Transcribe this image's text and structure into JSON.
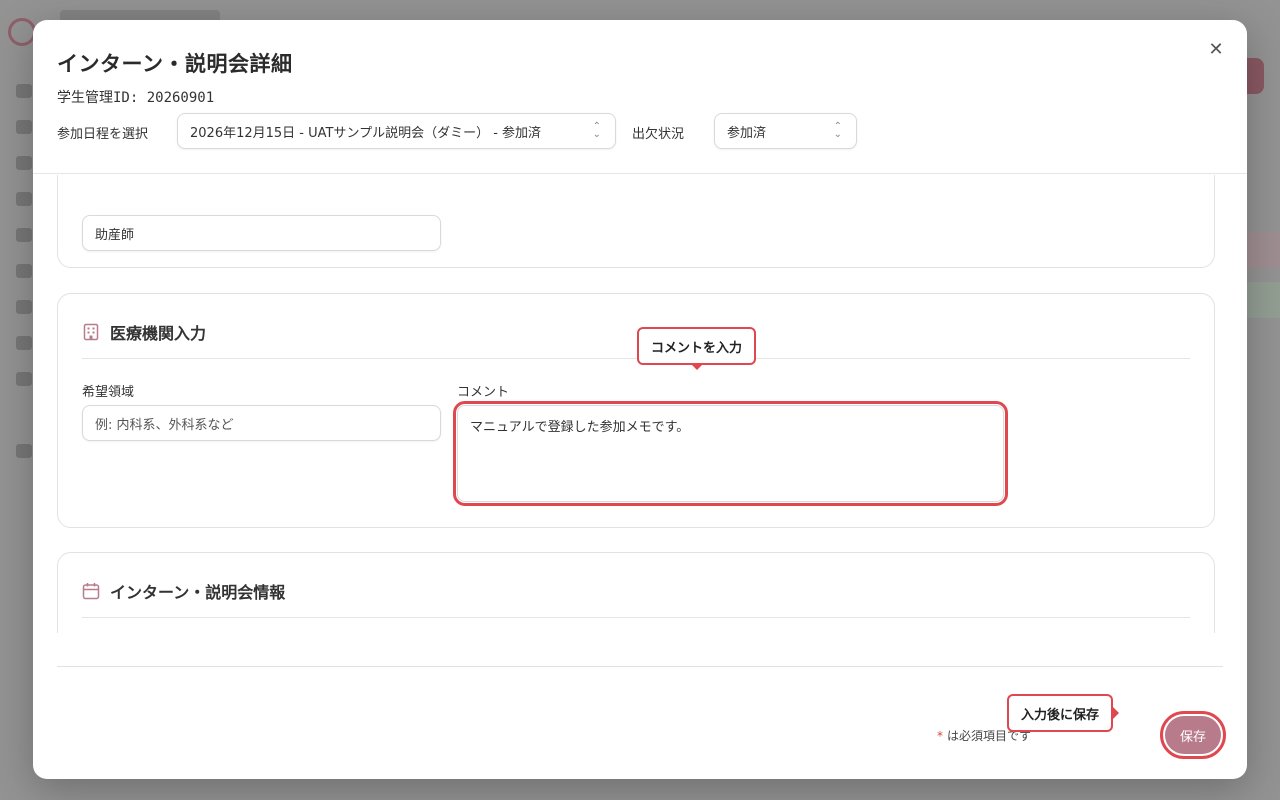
{
  "modal": {
    "title": "インターン・説明会詳細",
    "student_id": "学生管理ID: 20260901",
    "close_icon": "✕"
  },
  "schedule": {
    "label": "参加日程を選択",
    "value": "2026年12月15日 - UATサンプル説明会（ダミー） - 参加済"
  },
  "attendance": {
    "label": "出欠状況",
    "value": "参加済"
  },
  "card_profession": {
    "value": "助産師"
  },
  "card_medical": {
    "title": "医療機関入力",
    "icon": "building-icon",
    "desired_area_label": "希望領域",
    "desired_area_placeholder": "例: 内科系、外科系など",
    "comment_label": "コメント",
    "comment_value": "マニュアルで登録した参加メモです。"
  },
  "card_info": {
    "title": "インターン・説明会情報",
    "icon": "calendar-icon"
  },
  "callouts": {
    "comment": "コメントを入力",
    "save": "入力後に保存"
  },
  "footer": {
    "required_star": "*",
    "required_note": "は必須項目です",
    "save_label": "保存"
  },
  "colors": {
    "accent": "#b87b8c",
    "highlight": "#e04850"
  }
}
